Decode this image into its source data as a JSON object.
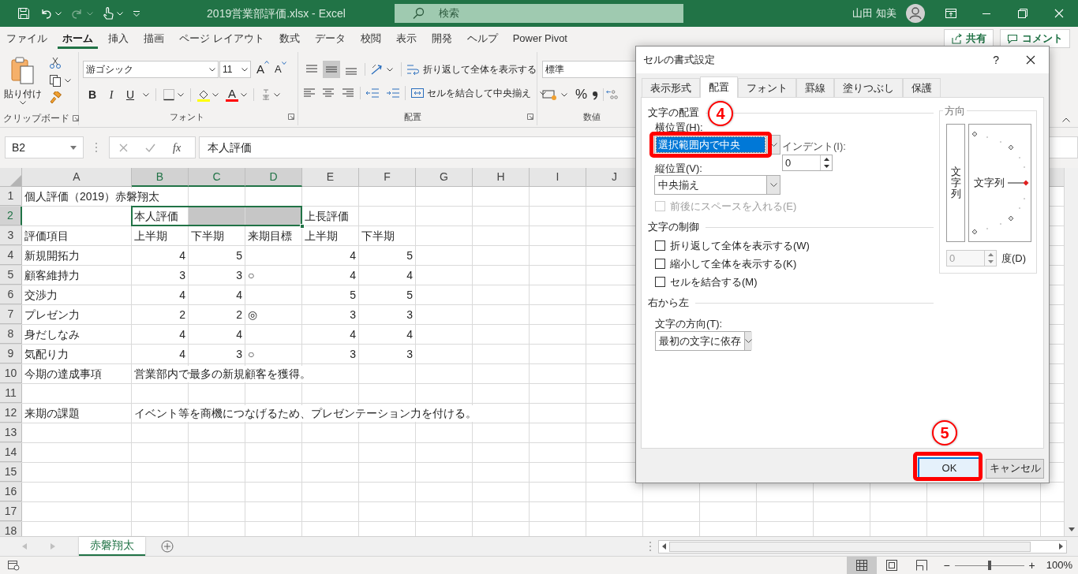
{
  "title_bar": {
    "title": "2019営業部評価.xlsx  -  Excel",
    "search_placeholder": "検索",
    "user_name": "山田 知美"
  },
  "ribbon_tabs": [
    {
      "label": "ファイル",
      "selected": false
    },
    {
      "label": "ホーム",
      "selected": true
    },
    {
      "label": "挿入",
      "selected": false
    },
    {
      "label": "描画",
      "selected": false
    },
    {
      "label": "ページ レイアウト",
      "selected": false
    },
    {
      "label": "数式",
      "selected": false
    },
    {
      "label": "データ",
      "selected": false
    },
    {
      "label": "校閲",
      "selected": false
    },
    {
      "label": "表示",
      "selected": false
    },
    {
      "label": "開発",
      "selected": false
    },
    {
      "label": "ヘルプ",
      "selected": false
    },
    {
      "label": "Power Pivot",
      "selected": false
    }
  ],
  "share_button": "共有",
  "comment_button": "コメント",
  "ribbon": {
    "paste_label": "貼り付け",
    "clipboard_group": "クリップボード",
    "font_name": "游ゴシック",
    "font_size": "11",
    "grow_font": "A",
    "shrink_font": "A",
    "bold": "B",
    "italic": "I",
    "underline": "U",
    "font_color": "A",
    "font_group": "フォント",
    "vertical_align": [
      {
        "kind": "top",
        "selected": false
      },
      {
        "kind": "middle",
        "selected": true
      },
      {
        "kind": "bottom",
        "selected": false
      }
    ],
    "wrap_text": "折り返して全体を表示する",
    "merge_center": "セルを結合して中央揃え",
    "alignment_group": "配置",
    "number_format": "標準",
    "percent": "%",
    "number_group": "数値"
  },
  "formula_bar": {
    "name_box": "B2",
    "function_button": "fx",
    "content": "本人評価"
  },
  "sheet": {
    "columns": [
      {
        "label": "A",
        "selected": false
      },
      {
        "label": "B",
        "selected": true
      },
      {
        "label": "C",
        "selected": true
      },
      {
        "label": "D",
        "selected": true
      },
      {
        "label": "E",
        "selected": false
      },
      {
        "label": "F",
        "selected": false
      },
      {
        "label": "G",
        "selected": false
      },
      {
        "label": "H",
        "selected": false
      },
      {
        "label": "I",
        "selected": false
      },
      {
        "label": "J",
        "selected": false
      }
    ],
    "rows": [
      {
        "number": "1",
        "selected": false,
        "cells": [
          "個人評価（2019）赤磐翔太"
        ]
      },
      {
        "number": "2",
        "selected": true,
        "cells": [
          null,
          "本人評価",
          {
            "selected": true
          },
          {
            "selected": true
          },
          "上長評価"
        ]
      },
      {
        "number": "3",
        "selected": false,
        "cells": [
          "評価項目",
          "上半期",
          "下半期",
          "来期目標",
          "上半期",
          "下半期"
        ]
      },
      {
        "number": "4",
        "selected": false,
        "cells": [
          "新規開拓力",
          {
            "number": "4"
          },
          {
            "number": "5"
          },
          null,
          {
            "number": "4"
          },
          {
            "number": "5"
          }
        ]
      },
      {
        "number": "5",
        "selected": false,
        "cells": [
          "顧客維持力",
          {
            "number": "3"
          },
          {
            "number": "3"
          },
          "○",
          {
            "number": "4"
          },
          {
            "number": "4"
          }
        ]
      },
      {
        "number": "6",
        "selected": false,
        "cells": [
          "交渉力",
          {
            "number": "4"
          },
          {
            "number": "4"
          },
          null,
          {
            "number": "5"
          },
          {
            "number": "5"
          }
        ]
      },
      {
        "number": "7",
        "selected": false,
        "cells": [
          "プレゼン力",
          {
            "number": "2"
          },
          {
            "number": "2"
          },
          "◎",
          {
            "number": "3"
          },
          {
            "number": "3"
          }
        ]
      },
      {
        "number": "8",
        "selected": false,
        "cells": [
          "身だしなみ",
          {
            "number": "4"
          },
          {
            "number": "4"
          },
          null,
          {
            "number": "4"
          },
          {
            "number": "4"
          }
        ]
      },
      {
        "number": "9",
        "selected": false,
        "cells": [
          "気配り力",
          {
            "number": "4"
          },
          {
            "number": "3"
          },
          "○",
          {
            "number": "3"
          },
          {
            "number": "3"
          }
        ]
      },
      {
        "number": "10",
        "selected": false,
        "cells": [
          "今期の達成事項",
          "営業部内で最多の新規顧客を獲得。"
        ]
      },
      {
        "number": "11",
        "selected": false
      },
      {
        "number": "12",
        "selected": false,
        "cells": [
          "来期の課題",
          "イベント等を商機につなげるため、プレゼンテーション力を付ける。"
        ]
      },
      {
        "number": "13",
        "selected": false
      },
      {
        "number": "14",
        "selected": false
      },
      {
        "number": "15",
        "selected": false
      },
      {
        "number": "16",
        "selected": false
      },
      {
        "number": "17",
        "selected": false
      },
      {
        "number": "18",
        "selected": false
      }
    ]
  },
  "sheet_tabs": [
    {
      "label": "赤磐翔太",
      "selected": true
    }
  ],
  "status_bar": {
    "view_buttons": [
      {
        "kind": "normal",
        "selected": true
      },
      {
        "kind": "page_layout",
        "selected": false
      },
      {
        "kind": "page_break",
        "selected": false
      }
    ],
    "zoom_out": "−",
    "zoom_in": "+",
    "zoom_slider": {
      "level": 0.5
    },
    "zoom": "100%"
  },
  "dialog": {
    "title": "セルの書式設定",
    "help": "?",
    "tabs": [
      {
        "label": "表示形式",
        "selected": false
      },
      {
        "label": "配置",
        "selected": true
      },
      {
        "label": "フォント",
        "selected": false
      },
      {
        "label": "罫線",
        "selected": false
      },
      {
        "label": "塗りつぶし",
        "selected": false
      },
      {
        "label": "保護",
        "selected": false
      }
    ],
    "text_alignment": {
      "heading": "文字の配置",
      "horizontal": {
        "label": "横位置(H):",
        "value": "選択範囲内で中央",
        "focused": true
      },
      "indent_label": "インデント(I):",
      "indent_value": "0",
      "vertical": {
        "label": "縦位置(V):",
        "value": "中央揃え",
        "focused": false
      },
      "distributed": {
        "label": "前後にスペースを入れる(E)",
        "checked": false,
        "disabled": true
      }
    },
    "text_control": {
      "heading": "文字の制御",
      "options": [
        {
          "label": "折り返して全体を表示する(W)",
          "checked": false,
          "disabled": false
        },
        {
          "label": "縮小して全体を表示する(K)",
          "checked": false,
          "disabled": false
        },
        {
          "label": "セルを結合する(M)",
          "checked": false,
          "disabled": false
        }
      ]
    },
    "right_to_left": {
      "heading": "右から左",
      "direction_label": "文字の方向(T):",
      "direction_value": "最初の文字に依存"
    },
    "orientation": {
      "heading": "方向",
      "vertical_text": "文字列",
      "dial_text": "文字列",
      "degrees_value": "0",
      "degrees_label": "度(D)"
    },
    "buttons": [
      {
        "label": "OK",
        "kind": "default"
      },
      {
        "label": "キャンセル",
        "kind": "normal"
      }
    ]
  },
  "annotations": [
    {
      "number": "4"
    },
    {
      "number": "5"
    }
  ]
}
